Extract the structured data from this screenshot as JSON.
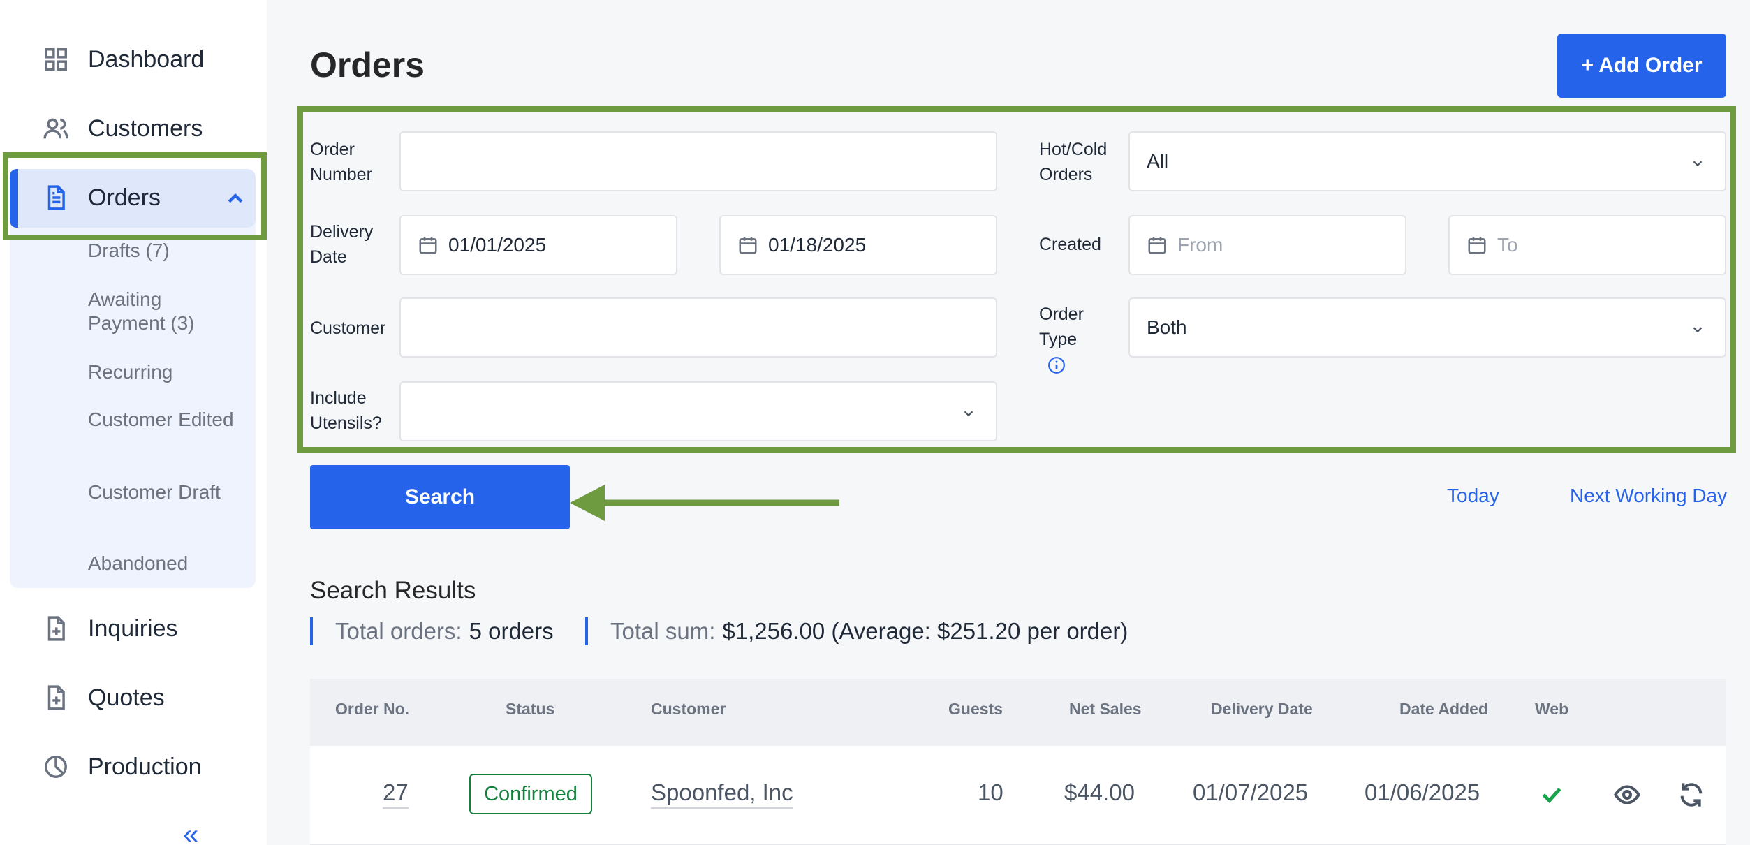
{
  "sidebar": {
    "items": [
      {
        "label": "Dashboard",
        "icon": "grid-icon"
      },
      {
        "label": "Customers",
        "icon": "users-icon"
      },
      {
        "label": "Orders",
        "icon": "document-icon"
      },
      {
        "label": "Inquiries",
        "icon": "file-plus-icon"
      },
      {
        "label": "Quotes",
        "icon": "file-plus-icon"
      },
      {
        "label": "Production",
        "icon": "pie-chart-icon"
      }
    ],
    "order_subitems": [
      "Drafts (7)",
      "Awaiting Payment (3)",
      "Recurring",
      "Customer Edited",
      "Customer Draft",
      "Abandoned"
    ],
    "collapse_glyph": "«"
  },
  "header": {
    "title": "Orders",
    "add_button": "+ Add Order"
  },
  "filters": {
    "order_number_label": "Order Number",
    "order_number_value": "",
    "delivery_date_label": "Delivery Date",
    "delivery_from": "01/01/2025",
    "delivery_to": "01/18/2025",
    "customer_label": "Customer",
    "customer_value": "",
    "utensils_label": "Include Utensils?",
    "utensils_value": "",
    "hotcold_label": "Hot/Cold Orders",
    "hotcold_value": "All",
    "created_label": "Created",
    "created_from_placeholder": "From",
    "created_to_placeholder": "To",
    "order_type_label": "Order Type",
    "order_type_value": "Both"
  },
  "actions": {
    "search": "Search",
    "today": "Today",
    "next_working_day": "Next Working Day"
  },
  "results": {
    "title": "Search Results",
    "total_orders_label": "Total orders:",
    "total_orders_value": "5 orders",
    "total_sum_label": "Total sum:",
    "total_sum_value": "$1,256.00 (Average: $251.20 per order)"
  },
  "table": {
    "columns": [
      "Order No.",
      "Status",
      "Customer",
      "Guests",
      "Net Sales",
      "Delivery Date",
      "Date Added",
      "Web"
    ],
    "rows": [
      {
        "order_no": "27",
        "status": "Confirmed",
        "customer": "Spoonfed, Inc",
        "guests": "10",
        "net_sales": "$44.00",
        "delivery_date": "01/07/2025",
        "date_added": "01/06/2025",
        "web": "check"
      }
    ]
  },
  "colors": {
    "accent": "#2563eb",
    "highlight": "#6e9a40",
    "confirmed": "#15803d"
  }
}
